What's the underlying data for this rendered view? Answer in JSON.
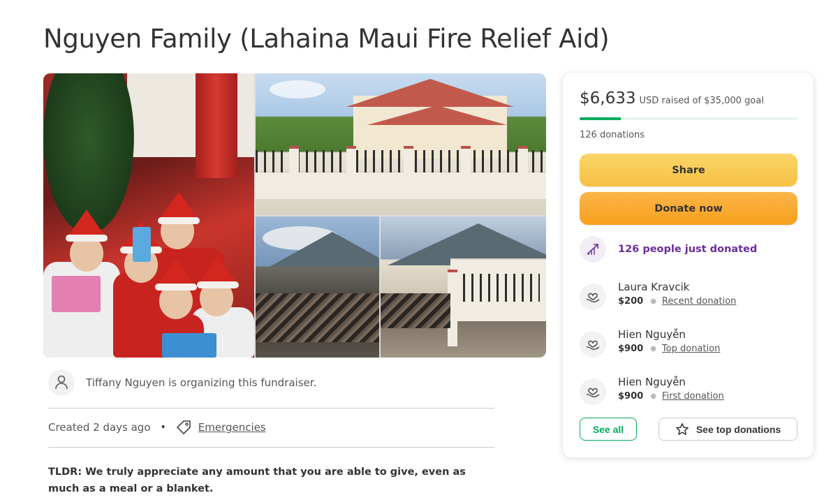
{
  "page": {
    "title": "Nguyen Family (Lahaina Maui Fire Relief Aid)"
  },
  "organizer": {
    "text": "Tiffany Nguyen is organizing this fundraiser."
  },
  "meta": {
    "created": "Created 2 days ago",
    "dot": "•",
    "category": "Emergencies"
  },
  "story": {
    "tldr": "TLDR: We truly appreciate any amount that you are able to give, even as much as a meal or a blanket."
  },
  "sidebar": {
    "raised_amount": "$6,633",
    "raised_rest": "USD raised of $35,000 goal",
    "progress_fraction": 0.19,
    "donations_count": "126 donations",
    "share_label": "Share",
    "donate_label": "Donate now",
    "just_donated": "126 people just donated",
    "donors": [
      {
        "name": "Laura Kravcik",
        "amount": "$200",
        "label": "Recent donation"
      },
      {
        "name": "Hien Nguyễn",
        "amount": "$900",
        "label": "Top donation"
      },
      {
        "name": "Hien Nguyễn",
        "amount": "$900",
        "label": "First donation"
      }
    ],
    "see_all_label": "See all",
    "see_top_label": "See top donations"
  },
  "colors": {
    "brand_green": "#02a95c",
    "share_yellow": "#f6c143",
    "donate_orange": "#f7a01d",
    "trend_purple": "#6b2d9c"
  },
  "icons": {
    "organizer": "user-icon",
    "category": "tag-icon",
    "trend": "trending-up-icon",
    "donor": "heart-hand-icon",
    "star": "star-icon"
  }
}
